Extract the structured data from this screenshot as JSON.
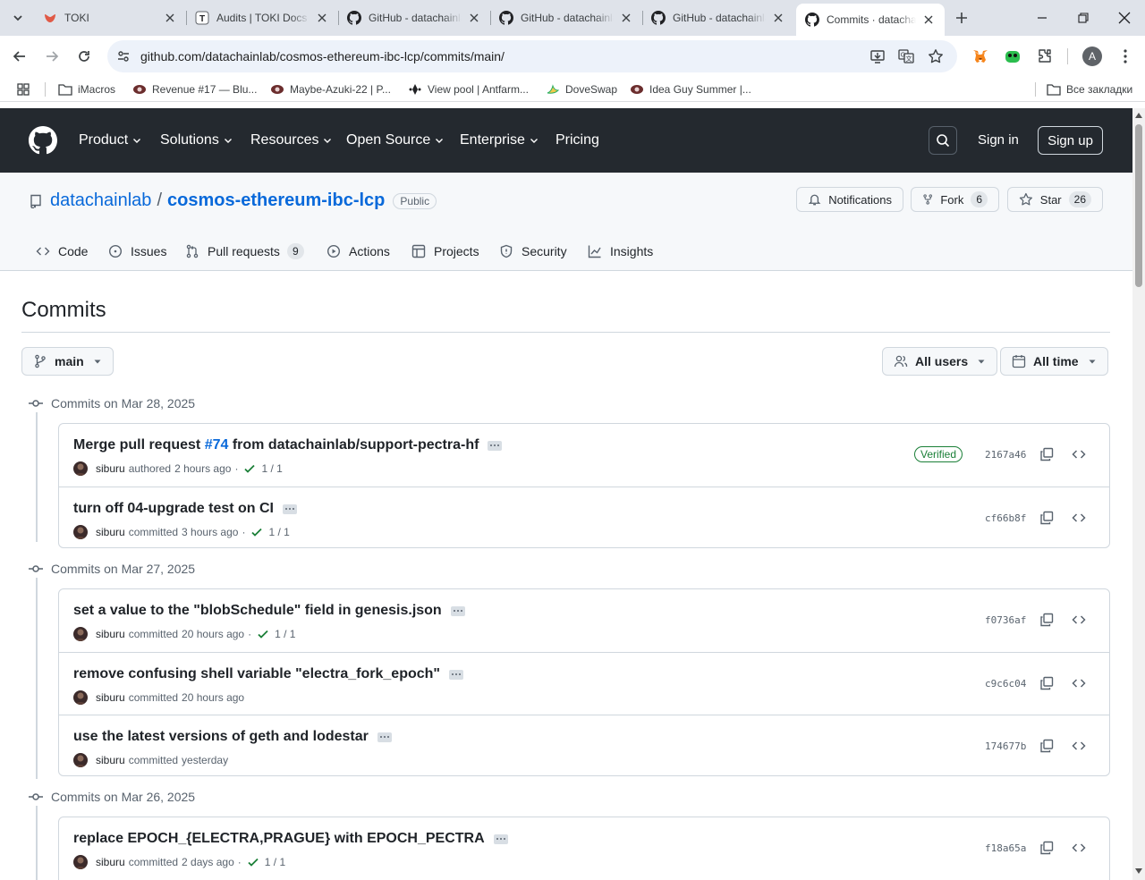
{
  "browser": {
    "tabs": [
      {
        "label": "TOKI",
        "favicon": "toki-icon"
      },
      {
        "label": "Audits | TOKI Docs",
        "favicon": "docs-icon"
      },
      {
        "label": "GitHub - datachainlab",
        "favicon": "github-icon"
      },
      {
        "label": "GitHub - datachainlab",
        "favicon": "github-icon"
      },
      {
        "label": "GitHub - datachainlab",
        "favicon": "github-icon"
      },
      {
        "label": "Commits · datachainlab",
        "favicon": "github-icon",
        "active": true
      }
    ],
    "url": "github.com/datachainlab/cosmos-ethereum-ibc-lcp/commits/main/",
    "profile_initial": "A",
    "bookmarks": [
      {
        "label": "iMacros"
      },
      {
        "label": "Revenue #17 — Blu..."
      },
      {
        "label": "Maybe-Azuki-22 | P..."
      },
      {
        "label": "View pool | Antfarm..."
      },
      {
        "label": "DoveSwap"
      },
      {
        "label": "Idea Guy Summer |..."
      }
    ],
    "all_bookmarks": "Все закладки"
  },
  "github": {
    "nav": [
      "Product",
      "Solutions",
      "Resources",
      "Open Source",
      "Enterprise",
      "Pricing"
    ],
    "sign_in": "Sign in",
    "sign_up": "Sign up"
  },
  "repo": {
    "owner": "datachainlab",
    "name": "cosmos-ethereum-ibc-lcp",
    "visibility": "Public",
    "notifications": "Notifications",
    "fork_label": "Fork",
    "fork_count": "6",
    "star_label": "Star",
    "star_count": "26",
    "tabs": {
      "code": "Code",
      "issues": "Issues",
      "pulls": "Pull requests",
      "pulls_count": "9",
      "actions": "Actions",
      "projects": "Projects",
      "security": "Security",
      "insights": "Insights"
    }
  },
  "commits_page": {
    "title": "Commits",
    "branch": "main",
    "users_filter": "All users",
    "time_filter": "All time"
  },
  "groups": [
    {
      "date": "Commits on Mar 28, 2025",
      "commits": [
        {
          "msg_prefix": "Merge pull request ",
          "pr": "#74",
          "msg_suffix": " from datachainlab/support-pectra-hf",
          "author": "siburu",
          "action": "authored",
          "time": "2 hours ago",
          "checks": "1 / 1",
          "verified": "Verified",
          "sha": "2167a46"
        },
        {
          "msg_prefix": "turn off 04-upgrade test on CI",
          "author": "siburu",
          "action": "committed",
          "time": "3 hours ago",
          "checks": "1 / 1",
          "sha": "cf66b8f"
        }
      ]
    },
    {
      "date": "Commits on Mar 27, 2025",
      "commits": [
        {
          "msg_prefix": "set a value to the \"blobSchedule\" field in genesis.json",
          "author": "siburu",
          "action": "committed",
          "time": "20 hours ago",
          "checks": "1 / 1",
          "sha": "f0736af"
        },
        {
          "msg_prefix": "remove confusing shell variable \"electra_fork_epoch\"",
          "author": "siburu",
          "action": "committed",
          "time": "20 hours ago",
          "sha": "c9c6c04"
        },
        {
          "msg_prefix": "use the latest versions of geth and lodestar",
          "author": "siburu",
          "action": "committed",
          "time": "yesterday",
          "sha": "174677b"
        }
      ]
    },
    {
      "date": "Commits on Mar 26, 2025",
      "commits": [
        {
          "msg_prefix": "replace EPOCH_{ELECTRA,PRAGUE} with EPOCH_PECTRA",
          "author": "siburu",
          "action": "committed",
          "time": "2 days ago",
          "checks": "1 / 1",
          "sha": "f18a65a"
        }
      ]
    }
  ]
}
